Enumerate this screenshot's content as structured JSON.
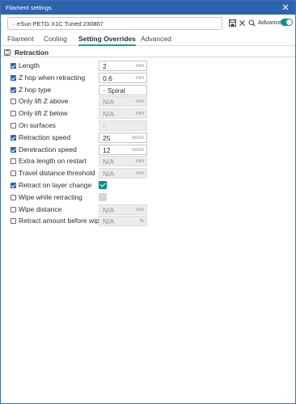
{
  "window": {
    "title": "Filament settings"
  },
  "toolbar": {
    "preset": "eSun PETG X1C Tuned 230807",
    "advanced_label": "Advanced",
    "advanced_on": true
  },
  "tabs": [
    {
      "label": "Filament",
      "active": false
    },
    {
      "label": "Cooling",
      "active": false
    },
    {
      "label": "Setting Overrides",
      "active": true
    },
    {
      "label": "Advanced",
      "active": false
    }
  ],
  "group": {
    "title": "Retraction"
  },
  "rows": [
    {
      "label": "Length",
      "checked": true,
      "kind": "num",
      "value": "2",
      "unit": "mm",
      "enabled": true
    },
    {
      "label": "Z hop when retracting",
      "checked": true,
      "kind": "num",
      "value": "0.6",
      "unit": "mm",
      "enabled": true
    },
    {
      "label": "Z hop type",
      "checked": true,
      "kind": "combo",
      "value": "Spiral",
      "unit": "",
      "enabled": true
    },
    {
      "label": "Only lift Z above",
      "checked": false,
      "kind": "num",
      "value": "N/A",
      "unit": "mm",
      "enabled": false
    },
    {
      "label": "Only lift Z below",
      "checked": false,
      "kind": "num",
      "value": "N/A",
      "unit": "mm",
      "enabled": false
    },
    {
      "label": "On surfaces",
      "checked": false,
      "kind": "combo",
      "value": "",
      "unit": "",
      "enabled": false
    },
    {
      "label": "Retraction speed",
      "checked": true,
      "kind": "num",
      "value": "25",
      "unit": "mm/s",
      "enabled": true
    },
    {
      "label": "Deretraction speed",
      "checked": true,
      "kind": "num",
      "value": "12",
      "unit": "mm/s",
      "enabled": true
    },
    {
      "label": "Extra length on restart",
      "checked": false,
      "kind": "num",
      "value": "N/A",
      "unit": "mm",
      "enabled": false
    },
    {
      "label": "Travel distance threshold",
      "checked": false,
      "kind": "num",
      "value": "N/A",
      "unit": "mm",
      "enabled": false
    },
    {
      "label": "Retract on layer change",
      "checked": true,
      "kind": "check",
      "value": "",
      "unit": "",
      "enabled": true,
      "state": true
    },
    {
      "label": "Wipe while retracting",
      "checked": false,
      "kind": "check",
      "value": "",
      "unit": "",
      "enabled": false,
      "state": false
    },
    {
      "label": "Wipe distance",
      "checked": false,
      "kind": "num",
      "value": "N/A",
      "unit": "mm",
      "enabled": false
    },
    {
      "label": "Retract amount before wipe",
      "checked": false,
      "kind": "num",
      "value": "N/A",
      "unit": "%",
      "enabled": false
    }
  ],
  "icons": {
    "combo_chevron": "chevron-down-icon",
    "save": "save-icon",
    "close": "close-icon",
    "search": "search-icon",
    "collapse": "collapse-icon"
  },
  "colors": {
    "titlebar": "#2d63ad",
    "accent": "#009688",
    "checkbox": "#2d63ad"
  }
}
